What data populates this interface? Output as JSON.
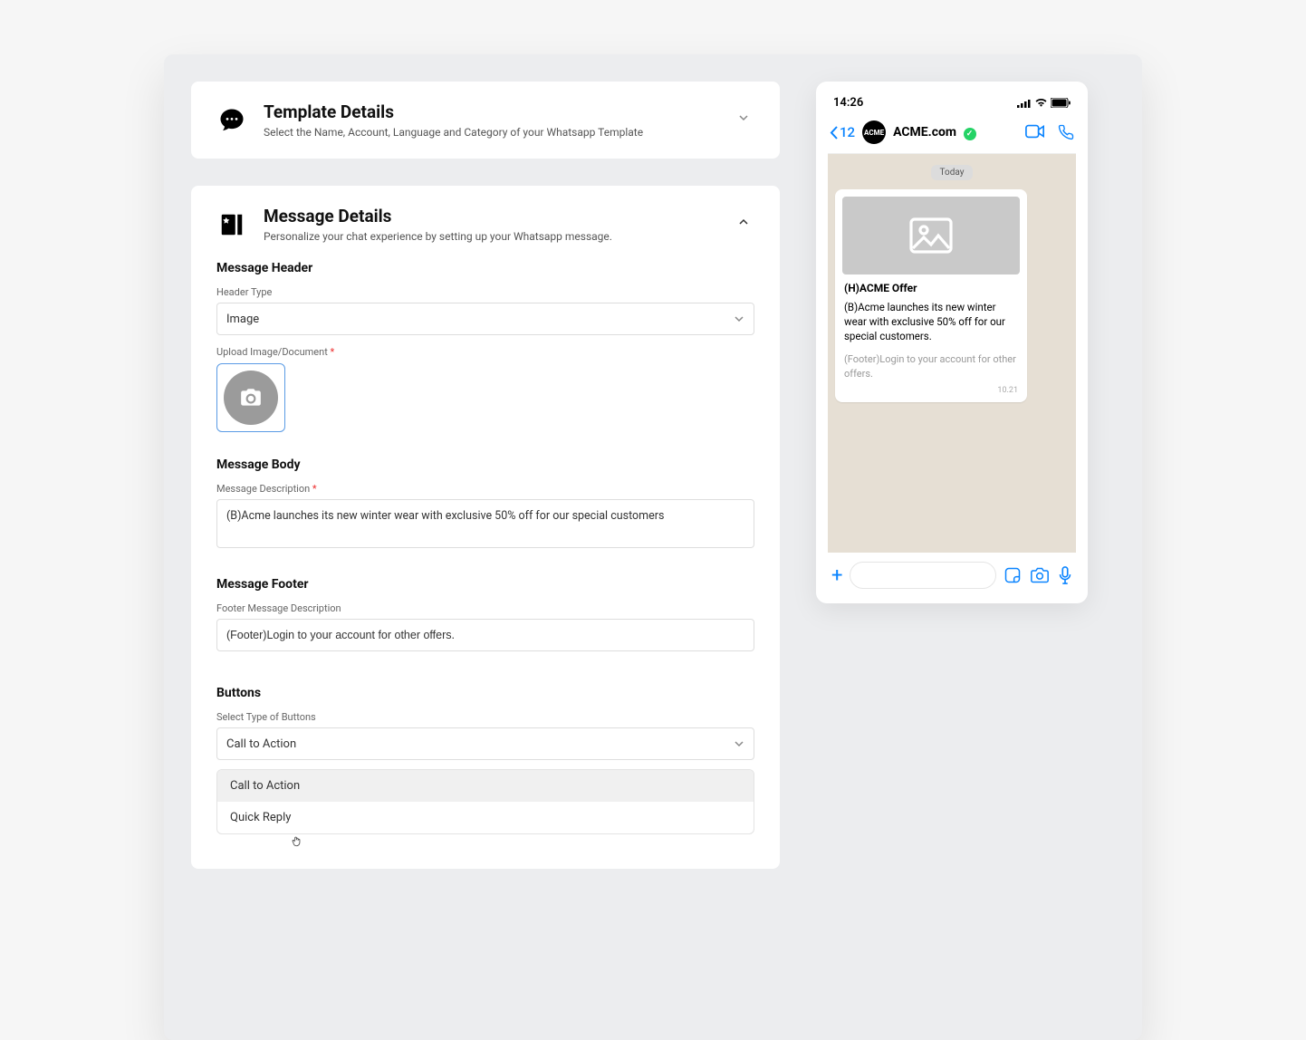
{
  "template_details": {
    "title": "Template Details",
    "subtitle": "Select the Name, Account, Language and Category of your Whatsapp Template"
  },
  "message_details": {
    "title": "Message Details",
    "subtitle": "Personalize your chat experience by setting up your Whatsapp message.",
    "header_section": "Message Header",
    "header_type_label": "Header Type",
    "header_type_value": "Image",
    "upload_label": "Upload Image/Document",
    "body_section": "Message Body",
    "body_label": "Message Description",
    "body_value": "(B)Acme launches its new winter wear with exclusive 50% off for our special customers",
    "footer_section": "Message Footer",
    "footer_label": "Footer Message Description",
    "footer_value": "(Footer)Login to your account for other offers.",
    "buttons_section": "Buttons",
    "buttons_label": "Select Type of Buttons",
    "buttons_value": "Call to Action",
    "button_options": {
      "opt0": "Call to Action",
      "opt1": "Quick Reply"
    }
  },
  "preview": {
    "time": "14:26",
    "back_count": "12",
    "contact": "ACME.com",
    "today": "Today",
    "msg_header": "(H)ACME Offer",
    "msg_body": "(B)Acme launches its new winter wear with exclusive 50% off for our special customers.",
    "msg_footer": "(Footer)Login to your account for other offers.",
    "msg_time": "10.21",
    "avatar_text": "ACME"
  }
}
